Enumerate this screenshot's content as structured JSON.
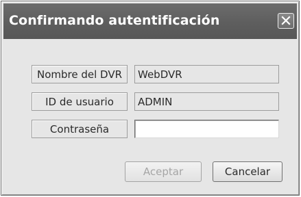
{
  "dialog": {
    "title": "Confirmando autentificación",
    "fields": [
      {
        "label": "Nombre del DVR",
        "value": "WebDVR",
        "editable": false
      },
      {
        "label": "ID de usuario",
        "value": "ADMIN",
        "editable": false
      },
      {
        "label": "Contraseña",
        "value": "",
        "editable": true
      }
    ],
    "buttons": {
      "accept": {
        "label": "Aceptar",
        "enabled": false
      },
      "cancel": {
        "label": "Cancelar",
        "enabled": true
      }
    },
    "icons": {
      "close": "close-icon"
    }
  }
}
